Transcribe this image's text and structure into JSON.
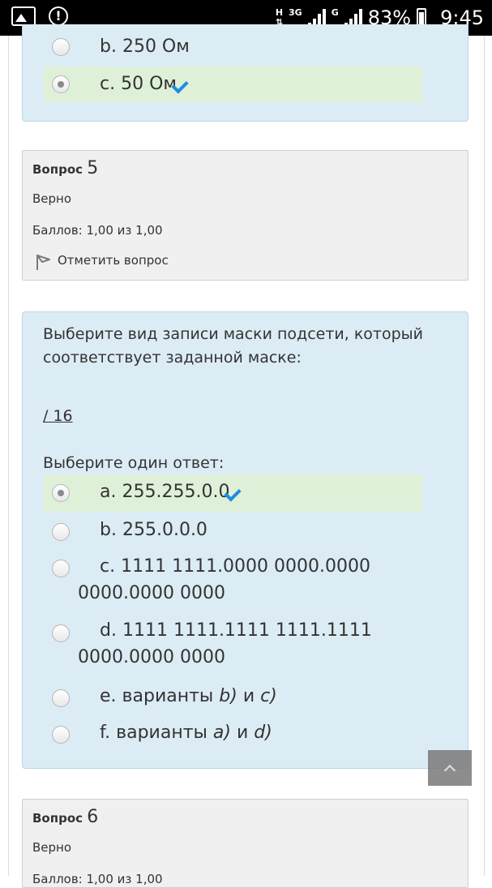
{
  "status_bar": {
    "network_h": "H",
    "network_3g": "3G",
    "network_g": "G",
    "battery": "83%",
    "time": "9:45"
  },
  "prev_question": {
    "options": [
      {
        "label": "b. 250 Ом",
        "checked": false,
        "correct": false
      },
      {
        "label": "c. 50 Ом",
        "checked": true,
        "correct": true
      }
    ]
  },
  "q5": {
    "label": "Вопрос",
    "number": "5",
    "state": "Верно",
    "grade": "Баллов: 1,00 из 1,00",
    "flag": "Отметить вопрос",
    "text": "Выберите вид записи маски подсети, который соответствует заданной маске:",
    "mask": "/ 16",
    "prompt": "Выберите один ответ:",
    "options": [
      {
        "letter": "a.",
        "text": "255.255.0.0",
        "checked": true,
        "correct": true
      },
      {
        "letter": "b.",
        "text": "255.0.0.0",
        "checked": false,
        "correct": false
      },
      {
        "letter": "c.",
        "line1": "1111 1111.0000 0000.0000",
        "line2": "0000.0000 0000",
        "checked": false,
        "correct": false
      },
      {
        "letter": "d.",
        "line1": "1111 1111.1111 1111.1111",
        "line2": "0000.0000 0000",
        "checked": false,
        "correct": false
      },
      {
        "letter": "e.",
        "text": "варианты",
        "v1": "b)",
        "conj": "и",
        "v2": "c)",
        "checked": false,
        "correct": false
      },
      {
        "letter": "f.",
        "text": "варианты",
        "v1": "a)",
        "conj": "и",
        "v2": "d)",
        "checked": false,
        "correct": false
      }
    ]
  },
  "q6": {
    "label": "Вопрос",
    "number": "6",
    "state": "Верно",
    "grade": "Баллов: 1,00 из 1,00"
  },
  "colors": {
    "info_bg": "#f0f0f0",
    "formulation_bg": "#dcecf5",
    "correct_bg": "#dff0d8",
    "check": "#1f8ce0"
  }
}
